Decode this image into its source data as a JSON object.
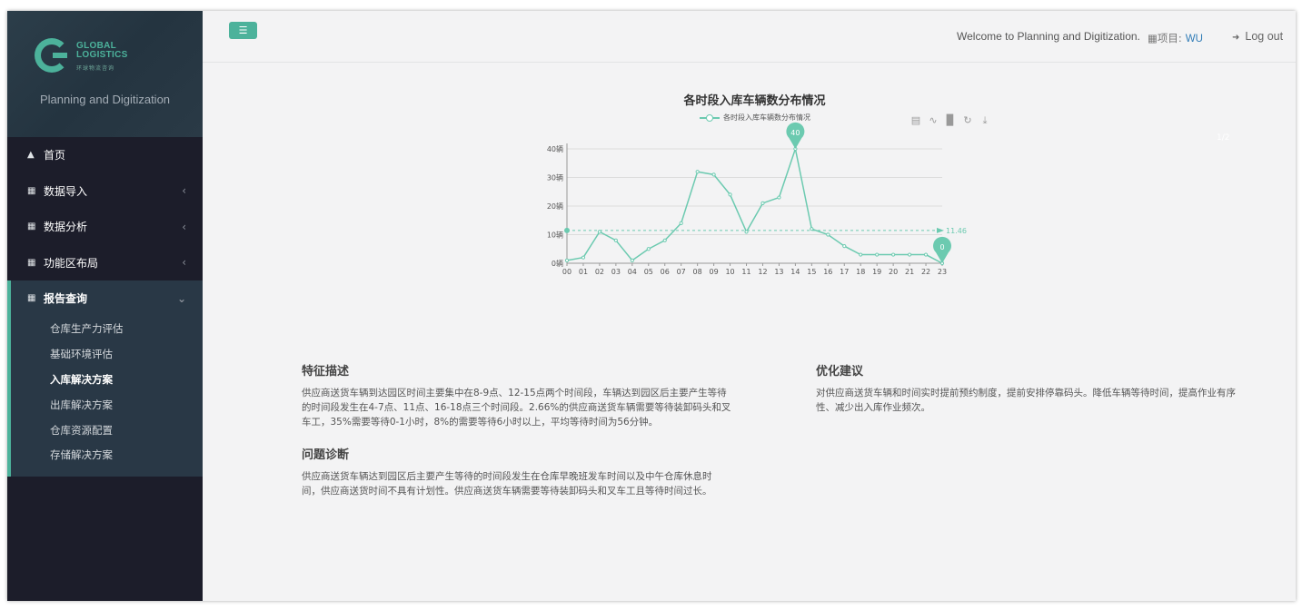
{
  "brand": {
    "logo_line1": "GLOBAL",
    "logo_line2": "LOGISTICS",
    "logo_sub": "环球物流咨询",
    "title": "Planning and Digitization"
  },
  "sidebar": {
    "items": [
      {
        "label": "首页",
        "icon": "inbox-icon"
      },
      {
        "label": "数据导入",
        "icon": "sitemap-icon"
      },
      {
        "label": "数据分析",
        "icon": "sitemap-icon"
      },
      {
        "label": "功能区布局",
        "icon": "sitemap-icon"
      }
    ],
    "group": {
      "label": "报告查询",
      "icon": "sitemap-icon",
      "children": [
        "仓库生产力评估",
        "基础环境评估",
        "入库解决方案",
        "出库解决方案",
        "仓库资源配置",
        "存储解决方案"
      ],
      "active_index": 2
    }
  },
  "topbar": {
    "menu_icon": "hamburger-icon",
    "welcome": "Welcome to Planning and Digitization.",
    "project_label": "项目:",
    "project_value": "WU",
    "logout": "Log out"
  },
  "page_indicator": "1/2",
  "colors": {
    "accent": "#4cb29b",
    "line": "#6ccab0",
    "link": "#2f7bb6"
  },
  "chart_data": {
    "type": "line",
    "title": "各时段入库车辆数分布情况",
    "legend": [
      "各时段入库车辆数分布情况"
    ],
    "x": [
      "00",
      "01",
      "02",
      "03",
      "04",
      "05",
      "06",
      "07",
      "08",
      "09",
      "10",
      "11",
      "12",
      "13",
      "14",
      "15",
      "16",
      "17",
      "18",
      "19",
      "20",
      "21",
      "22",
      "23"
    ],
    "series": [
      {
        "name": "各时段入库车辆数分布情况",
        "values": [
          1,
          2,
          11,
          8,
          1,
          5,
          8,
          14,
          32,
          31,
          24,
          11,
          21,
          23,
          40,
          12,
          10,
          6,
          3,
          3,
          3,
          3,
          3,
          0
        ]
      }
    ],
    "y_tick_labels": [
      "0辆",
      "10辆",
      "20辆",
      "30辆",
      "40辆"
    ],
    "ylim": [
      0,
      40
    ],
    "mark_line": {
      "label": "11.46",
      "value": 11.46
    },
    "mark_points": [
      {
        "label": "40",
        "x": "14",
        "value": 40
      },
      {
        "label": "0",
        "x": "23",
        "value": 0
      }
    ],
    "grid": true,
    "legend_position": "top-center",
    "toolbox": [
      "data-view-icon",
      "line-chart-icon",
      "bar-chart-icon",
      "restore-icon",
      "download-icon"
    ]
  },
  "sections": {
    "features": {
      "title": "特征描述",
      "lines": [
        "供应商送货车辆到达园区时间主要集中在8-9点、12-15点两个时间段，车辆达到园区后主要产生等待",
        "的时间段发生在4-7点、11点、16-18点三个时间段。2.66%的供应商送货车辆需要等待装卸码头和叉",
        "车工，35%需要等待0-1小时，8%的需要等待6小时以上，平均等待时间为56分钟。"
      ]
    },
    "diagnosis": {
      "title": "问题诊断",
      "lines": [
        "供应商送货车辆达到园区后主要产生等待的时间段发生在仓库早晚班发车时间以及中午仓库休息时",
        "间，供应商送货时间不具有计划性。供应商送货车辆需要等待装卸码头和叉车工且等待时间过长。"
      ]
    },
    "advice": {
      "title": "优化建议",
      "lines": [
        "对供应商送货车辆和时间实时提前预约制度，提前安排停靠码头。降低车辆等待时间，提高作业有序",
        "性、减少出入库作业频次。"
      ]
    }
  }
}
